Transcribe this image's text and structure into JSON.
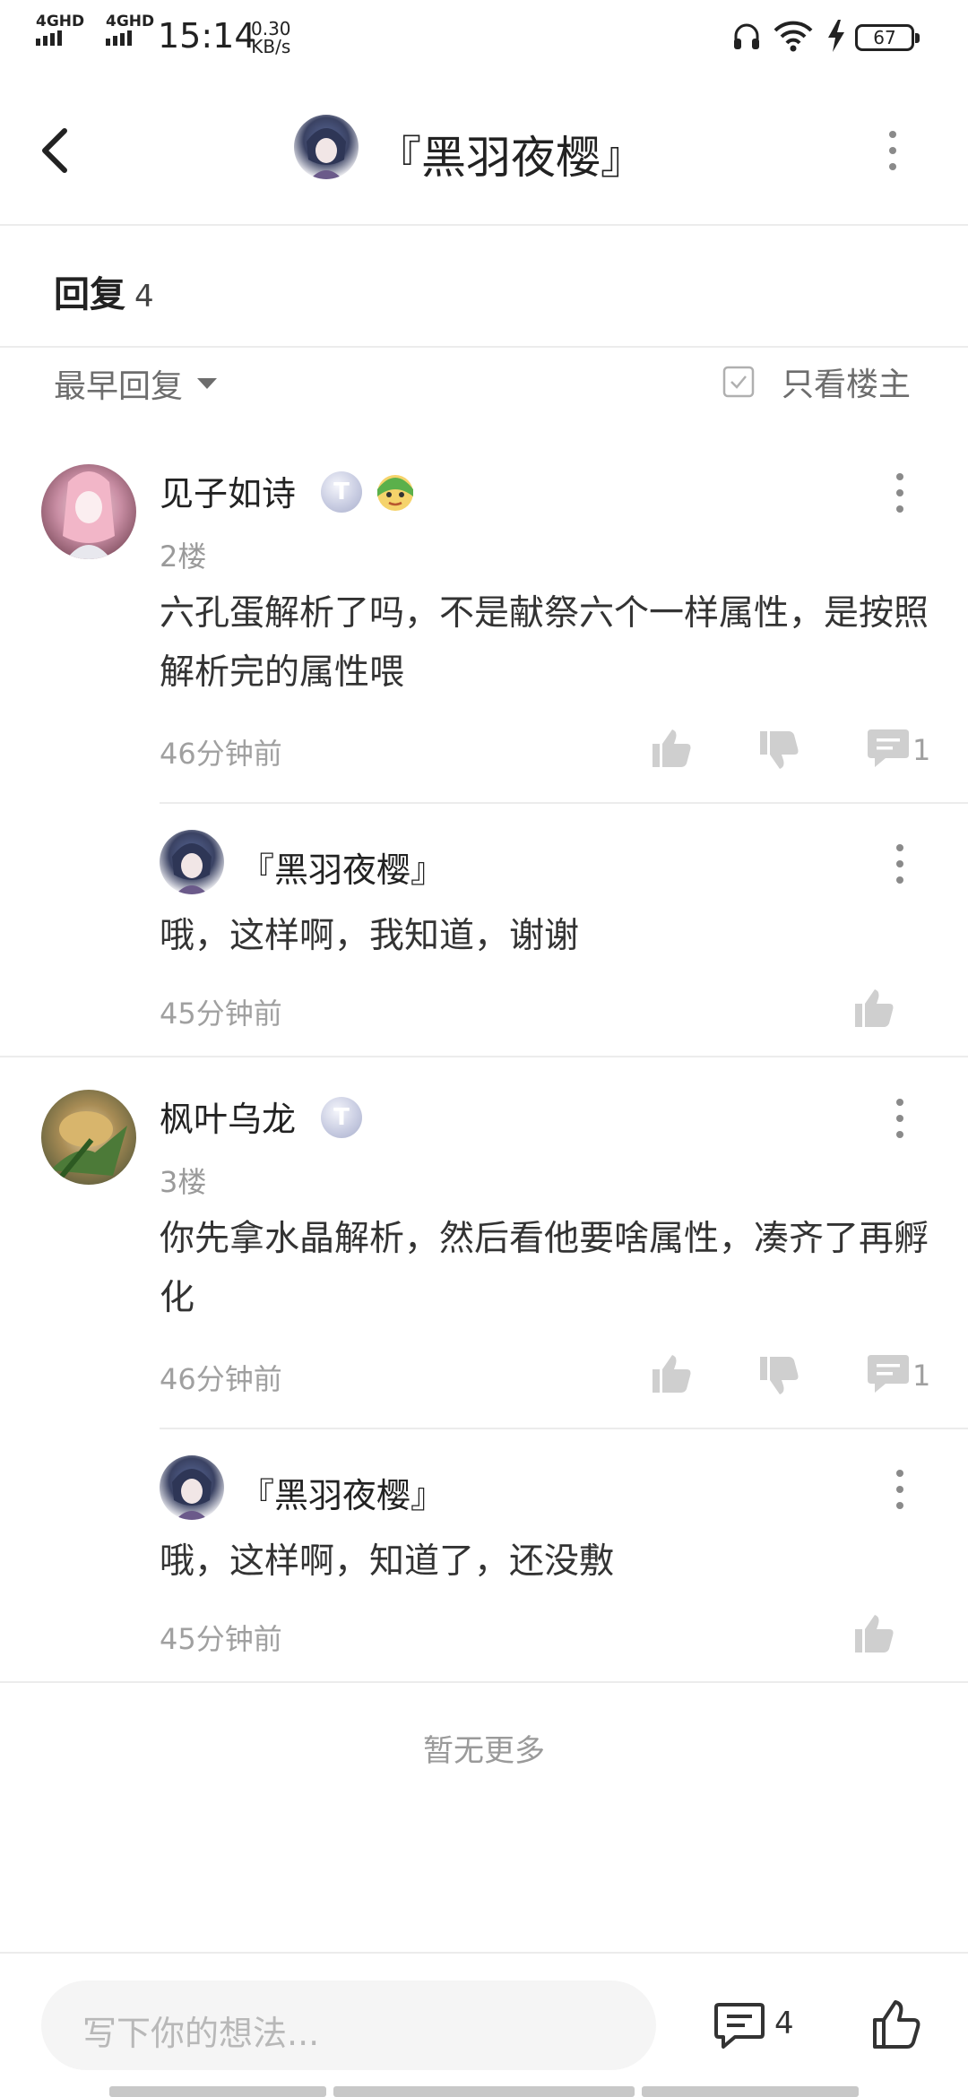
{
  "status_bar": {
    "network1": "4GHD",
    "network2": "4GHD",
    "time": "15:14",
    "speed_value": "0.30",
    "speed_unit": "KB/s",
    "battery": "67"
  },
  "header": {
    "title": "『黑羽夜樱』",
    "back_icon": "back-arrow-icon",
    "more_icon": "more-vertical-icon"
  },
  "replies": {
    "label": "回复",
    "count": "4"
  },
  "filter": {
    "sort_label": "最早回复",
    "only_op_label": "只看楼主"
  },
  "comments": [
    {
      "name": "见子如诗",
      "floor": "2楼",
      "content": "六孔蛋解析了吗，不是献祭六个一样属性，是按照解析完的属性喂",
      "time": "46分钟前",
      "reply_count": "1",
      "sub": {
        "name": "『黑羽夜樱』",
        "content": "哦，这样啊，我知道，谢谢",
        "time": "45分钟前"
      }
    },
    {
      "name": "枫叶乌龙",
      "floor": "3楼",
      "content": "你先拿水晶解析，然后看他要啥属性，凑齐了再孵化",
      "time": "46分钟前",
      "reply_count": "1",
      "sub": {
        "name": "『黑羽夜樱』",
        "content": "哦，这样啊，知道了，还没敷",
        "time": "45分钟前"
      }
    }
  ],
  "end_text": "暂无更多",
  "footer": {
    "placeholder": "写下你的想法...",
    "comment_count": "4"
  },
  "badge_text": "T",
  "colors": {
    "background": "#ffffff",
    "text": "#222222",
    "muted": "#9a9a9a",
    "divider": "#ececec",
    "icon_gray": "#cfcfcf"
  }
}
